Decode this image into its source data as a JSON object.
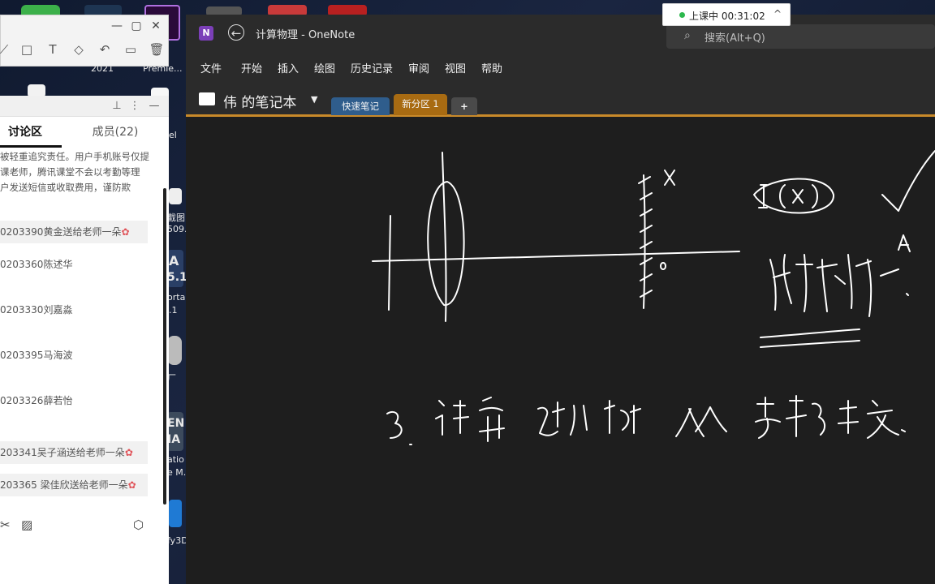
{
  "desktop": {
    "labels": {
      "l1": "2021",
      "l2": "Premie...",
      "l3": "el",
      "l4": "截图",
      "l5": "509.",
      "l6": "A",
      "l7": "5.1",
      "l8": "orta",
      "l9": ".1",
      "l10": "厂",
      "l11": "EN",
      "l12": "IA",
      "l13": "atio",
      "l14": "e M.",
      "l15": "fy3D"
    }
  },
  "draw_toolbar": {
    "minimize": "—",
    "restore": "▢",
    "close": "✕",
    "tools": [
      "⟋",
      "□",
      "T",
      "◇",
      "↶",
      "▭",
      "🗑"
    ]
  },
  "chat": {
    "tabs": {
      "discussion": "讨论区",
      "members": "成员(22)"
    },
    "notice": [
      "被轻重追究责任。用户手机账号仅提",
      "课老师，腾讯课堂不会以考勤等理",
      "户发送短信或收取费用，谨防欺"
    ],
    "messages": [
      {
        "text": "0203390黄金送给老师一朵",
        "gift": true
      },
      {
        "text": "0203360陈述华",
        "gift": false
      },
      {
        "text": "0203330刘嘉淼",
        "gift": false
      },
      {
        "text": "0203395马海波",
        "gift": false
      },
      {
        "text": "0203326薛若怡",
        "gift": false
      },
      {
        "text": "203341吴子涵送给老师一朵",
        "gift": true
      },
      {
        "text": "203365 梁佳欣送给老师一朵",
        "gift": true
      }
    ],
    "flower_icon": "✿"
  },
  "onenote": {
    "window_title": "计算物理  -  OneNote",
    "search_placeholder": "搜索(Alt+Q)",
    "menu": [
      "文件",
      "开始",
      "插入",
      "绘图",
      "历史记录",
      "审阅",
      "视图",
      "帮助"
    ],
    "notebook_name": "伟 的笔记本",
    "sections": {
      "quick": "快速笔记",
      "new": "新分区 1",
      "add": "+"
    }
  },
  "class_status": {
    "text": "上课中 00:31:02",
    "chevron": "^"
  },
  "colors": {
    "ink": "#ffffff",
    "accent_tab": "#a86b12",
    "quick_tab": "#2f5d8c"
  }
}
